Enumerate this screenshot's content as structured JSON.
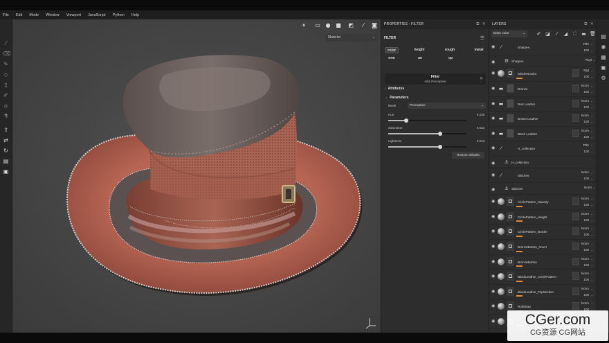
{
  "menu": [
    "File",
    "Edit",
    "Mode",
    "Window",
    "Viewport",
    "JavaScript",
    "Python",
    "Help"
  ],
  "left_toolbar": [
    "paint-brush-icon",
    "eraser-icon",
    "projection-icon",
    "polygon-fill-icon",
    "smudge-icon",
    "clone-icon",
    "color-picker-icon",
    "bake-icon",
    "export-icon",
    "share-icon",
    "history-icon",
    "plugin-icon",
    "settings-icon"
  ],
  "viewport": {
    "toolbar_icons": [
      "pause-icon",
      "2d-view-icon",
      "3d-view-icon",
      "camera-icon",
      "screenshot-icon",
      "paint-mode-icon",
      "render-icon"
    ],
    "material_select": "Material"
  },
  "properties": {
    "title": "PROPERTIES - FILTER",
    "filter_label": "FILTER",
    "channels": [
      "color",
      "height",
      "rough",
      "metal",
      "nrm",
      "ao",
      "op"
    ],
    "selected_channel": "color",
    "filter_name": "Filter",
    "filter_sub": "HSL Perceptive",
    "attributes_label": "Attributes",
    "parameters_label": "Parameters",
    "mode_label": "Mode",
    "mode_value": "Perceptive",
    "sliders": [
      {
        "label": "Hue",
        "value": "0.229",
        "frac": 0.229
      },
      {
        "label": "Saturation",
        "value": "0.532",
        "frac": 0.66
      },
      {
        "label": "Lightness",
        "value": "0.543",
        "frac": 0.66
      }
    ],
    "restore_label": "Restore defaults"
  },
  "layers": {
    "title": "LAYERS",
    "blend_mode": "Base color",
    "items": [
      {
        "name": "Sharpen",
        "type": "effect",
        "blend": "Pthr",
        "opacity": "100"
      },
      {
        "name": "Sharpen",
        "type": "sub",
        "blend": "Repl",
        "opacity": "100"
      },
      {
        "name": "StitchesColor",
        "type": "layer",
        "blend": "Sfgt",
        "opacity": "100"
      },
      {
        "name": "Bronze",
        "type": "folder",
        "blend": "Norm",
        "opacity": "100"
      },
      {
        "name": "Red Leather",
        "type": "folder",
        "blend": "Norm",
        "opacity": "100"
      },
      {
        "name": "Brown Leather",
        "type": "folder",
        "blend": "Norm",
        "opacity": "100"
      },
      {
        "name": "Black Leather",
        "type": "folder",
        "blend": "Norm",
        "opacity": "100"
      },
      {
        "name": "H_collection",
        "type": "effect",
        "blend": "Pthr",
        "opacity": "100"
      },
      {
        "name": "H_collection",
        "type": "anchor",
        "blend": "",
        "opacity": ""
      },
      {
        "name": "Stitches",
        "type": "effect",
        "blend": "Norm",
        "opacity": "100"
      },
      {
        "name": "Stitches",
        "type": "anchor",
        "blend": "Norm",
        "opacity": ""
      },
      {
        "name": "CirclePattern_Opacity",
        "type": "layer",
        "blend": "Norm",
        "opacity": "100"
      },
      {
        "name": "CirclePattern_Height",
        "type": "layer",
        "blend": "Norm",
        "opacity": "100"
      },
      {
        "name": "CirclePattern_Border",
        "type": "layer",
        "blend": "Norm",
        "opacity": "100"
      },
      {
        "name": "BronzeButton_Invert",
        "type": "layer",
        "blend": "Norm",
        "opacity": "100"
      },
      {
        "name": "BronzeButton",
        "type": "layer",
        "blend": "Norm",
        "opacity": "100"
      },
      {
        "name": "BlackLeather_CirclePattern",
        "type": "layer",
        "blend": "Norm",
        "opacity": "100"
      },
      {
        "name": "BlackLeather_TopSection",
        "type": "layer",
        "blend": "Norm",
        "opacity": "100"
      },
      {
        "name": "RollStrap",
        "type": "layer",
        "blend": "Norm",
        "opacity": "100"
      },
      {
        "name": "",
        "type": "layer",
        "blend": "Norm",
        "opacity": "100"
      }
    ]
  },
  "right_toolbar": [
    "layers-icon",
    "display-settings-icon",
    "viewer-icon",
    "camera-settings-icon",
    "history-icon"
  ],
  "watermark": {
    "big": "CGer.com",
    "small": "CG资源 CG网站"
  },
  "colors": {
    "accent": "#e08a3c",
    "panel": "#2d2d2d",
    "viewport": "#474747"
  }
}
